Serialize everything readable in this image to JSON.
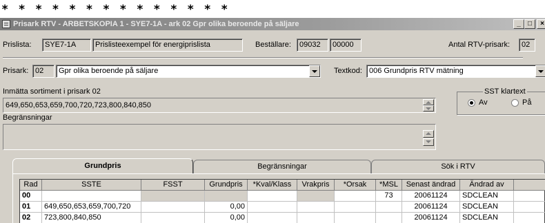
{
  "banner": "* * * * * * * * * * * * * *",
  "window": {
    "title": "Prisark RTV - ARBETSKOPIA 1 - SYE7-1A - ark 02 Gpr olika beroende på säljare",
    "minimize": "_",
    "maximize": "□",
    "close": "×"
  },
  "header": {
    "prislista_label": "Prislista:",
    "prislista_code": "SYE7-1A",
    "prislista_desc": "Prislisteexempel för energiprislista",
    "bestallare_label": "Beställare:",
    "bestallare_code": "09032",
    "bestallare_no": "00000",
    "antal_label": "Antal RTV-prisark:",
    "antal_value": "02"
  },
  "prisark": {
    "label": "Prisark:",
    "code": "02",
    "name": "Gpr olika beroende på säljare",
    "textkod_label": "Textkod:",
    "textkod_value": "006 Grundpris RTV mätning"
  },
  "sortiment": {
    "label": "Inmätta sortiment i prisark 02",
    "value": "649,650,653,659,700,720,723,800,840,850"
  },
  "sst": {
    "legend": "SST klartext",
    "av": "Av",
    "pa": "På",
    "selected": "av"
  },
  "begransningar": {
    "label": "Begränsningar",
    "value": ""
  },
  "tabs": [
    {
      "label": "Grundpris",
      "active": true
    },
    {
      "label": "Begränsningar",
      "active": false
    },
    {
      "label": "Sök i RTV",
      "active": false
    }
  ],
  "grid": {
    "columns": [
      "Rad",
      "SSTE",
      "FSST",
      "Grundpris",
      "*Kval/Klass",
      "Vrakpris",
      "*Orsak",
      "*MSL",
      "Senast ändrad",
      "Ändrad av",
      ""
    ],
    "rows": [
      {
        "rad": "00",
        "sste": "",
        "fsst": "",
        "grundpris": "",
        "kval": "",
        "vrak": "",
        "orsak": "",
        "msl": "73",
        "senast": "20061124",
        "andrad": "SDCLEAN",
        "extra": ""
      },
      {
        "rad": "01",
        "sste": "649,650,653,659,700,720",
        "fsst": "",
        "grundpris": "0,00",
        "kval": "",
        "vrak": "",
        "orsak": "",
        "msl": "",
        "senast": "20061124",
        "andrad": "SDCLEAN",
        "extra": ""
      },
      {
        "rad": "02",
        "sste": "723,800,840,850",
        "fsst": "",
        "grundpris": "0,00",
        "kval": "",
        "vrak": "",
        "orsak": "",
        "msl": "",
        "senast": "20061124",
        "andrad": "SDCLEAN",
        "extra": ""
      }
    ]
  }
}
